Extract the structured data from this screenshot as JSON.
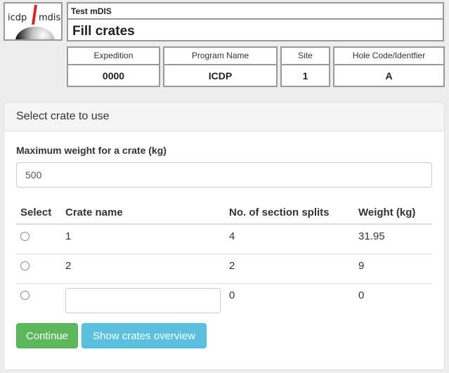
{
  "logo": {
    "left_text": "icdp",
    "right_text": "mdis",
    "icon": "icdp-mdis-logo-icon"
  },
  "header": {
    "app_name": "Test mDIS",
    "page_title": "Fill crates"
  },
  "info": [
    {
      "label": "Expedition",
      "value": "0000"
    },
    {
      "label": "Program Name",
      "value": "ICDP"
    },
    {
      "label": "Site",
      "value": "1"
    },
    {
      "label": "Hole Code/Identfier",
      "value": "A"
    }
  ],
  "panel": {
    "title": "Select crate to use",
    "max_weight_label": "Maximum weight for a crate (kg)",
    "max_weight_value": "500",
    "table": {
      "headers": [
        "Select",
        "Crate name",
        "No. of section splits",
        "Weight (kg)"
      ],
      "rows": [
        {
          "crate_name": "1",
          "splits": "4",
          "weight": "31.95"
        },
        {
          "crate_name": "2",
          "splits": "2",
          "weight": "9"
        },
        {
          "crate_name": "",
          "splits": "0",
          "weight": "0"
        }
      ]
    },
    "buttons": {
      "continue": "Continue",
      "overview": "Show crates overview"
    }
  },
  "colors": {
    "success": "#5cb85c",
    "info": "#5bc0de"
  }
}
